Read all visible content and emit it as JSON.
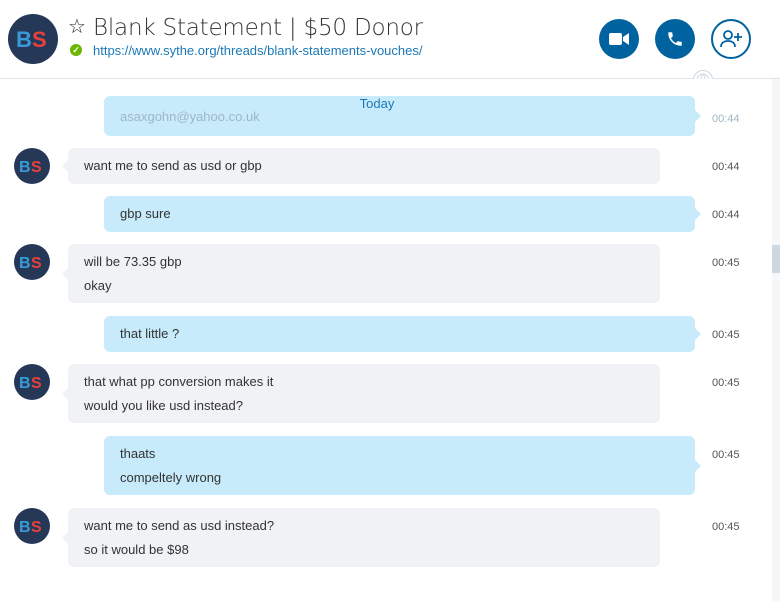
{
  "header": {
    "title": "Blank Statement | $50 Donor",
    "url": "https://www.sythe.org/threads/blank-statements-vouches/",
    "avatar_initials": "BS",
    "star_glyph": "☆",
    "verified_glyph": "✓"
  },
  "colors": {
    "accent": "#00629e",
    "incoming_bubble": "#f0f2f5",
    "outgoing_bubble": "#c7ebfb",
    "link": "#1a79b5"
  },
  "chat": {
    "day_label": "Today",
    "partial_outgoing": {
      "text": "asaxgohn@yahoo.co.uk",
      "time": "00:44"
    },
    "messages": [
      {
        "lines": [
          "want me to send as usd or gbp"
        ],
        "time": "00:44"
      },
      {
        "lines": [
          "gbp sure"
        ],
        "time": "00:44"
      },
      {
        "lines": [
          "will be 73.35 gbp",
          "okay"
        ],
        "time": "00:45"
      },
      {
        "lines": [
          "that little ?"
        ],
        "time": "00:45"
      },
      {
        "lines": [
          "that what pp conversion makes it",
          "would you like usd instead?"
        ],
        "time": "00:45"
      },
      {
        "lines": [
          "thaats",
          "compeltely wrong"
        ],
        "time": "00:45"
      },
      {
        "lines": [
          "want me to send as usd instead?",
          "so it would be $98"
        ],
        "time": "00:45"
      }
    ]
  }
}
